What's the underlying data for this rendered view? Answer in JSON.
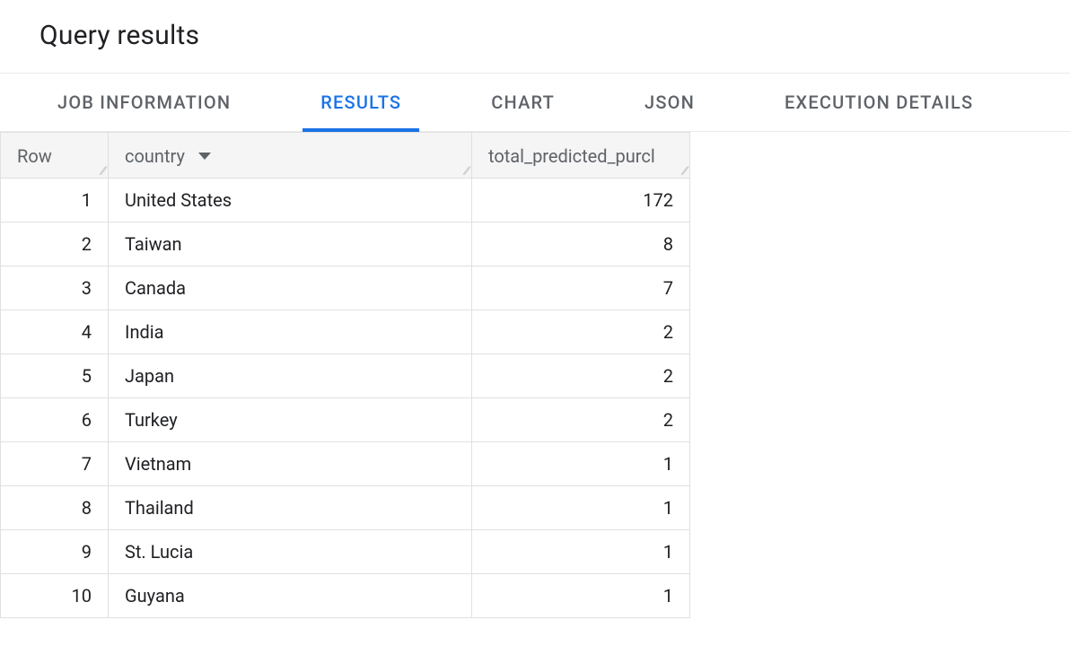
{
  "header": {
    "title": "Query results"
  },
  "tabs": [
    {
      "id": "job",
      "label": "JOB INFORMATION",
      "active": false
    },
    {
      "id": "results",
      "label": "RESULTS",
      "active": true
    },
    {
      "id": "chart",
      "label": "CHART",
      "active": false
    },
    {
      "id": "json",
      "label": "JSON",
      "active": false
    },
    {
      "id": "exec",
      "label": "EXECUTION DETAILS",
      "active": false
    }
  ],
  "table": {
    "columns": {
      "row": "Row",
      "country": "country",
      "value": "total_predicted_purcl"
    },
    "sort": {
      "column": "country",
      "direction": "desc"
    },
    "rows": [
      {
        "n": "1",
        "country": "United States",
        "value": "172"
      },
      {
        "n": "2",
        "country": "Taiwan",
        "value": "8"
      },
      {
        "n": "3",
        "country": "Canada",
        "value": "7"
      },
      {
        "n": "4",
        "country": "India",
        "value": "2"
      },
      {
        "n": "5",
        "country": "Japan",
        "value": "2"
      },
      {
        "n": "6",
        "country": "Turkey",
        "value": "2"
      },
      {
        "n": "7",
        "country": "Vietnam",
        "value": "1"
      },
      {
        "n": "8",
        "country": "Thailand",
        "value": "1"
      },
      {
        "n": "9",
        "country": "St. Lucia",
        "value": "1"
      },
      {
        "n": "10",
        "country": "Guyana",
        "value": "1"
      }
    ]
  }
}
